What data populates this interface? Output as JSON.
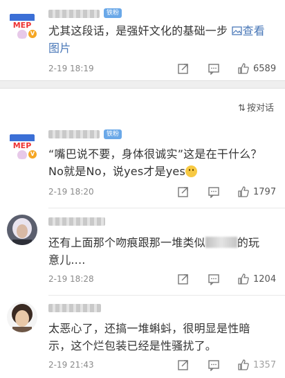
{
  "sort_label": "按对话",
  "comments": [
    {
      "badge": "铁粉",
      "text_parts": [
        "尤其这段话，是强奸文化的基础一步 ",
        "查看图片"
      ],
      "link_icon": "image-icon",
      "time": "2-19 18:19",
      "likes": "6589",
      "avatar_text": "MEP"
    },
    {
      "badge": "铁粉",
      "text_parts": [
        "“嘴巴说不要，身体很诚实”这是在干什么？No就是No，说yes才是yes"
      ],
      "time": "2-19 18:20",
      "likes": "1797",
      "avatar_text": "MEP"
    },
    {
      "text_parts": [
        "还有上面那个吻痕跟那一堆类似",
        "的玩意儿...."
      ],
      "time": "2-19 18:28",
      "likes": "1204"
    },
    {
      "text_parts": [
        "太恶心了，还搞一堆蝌蚪，很明显是性暗示，这个烂包装已经是性骚扰了。"
      ],
      "time": "2-19 21:43",
      "likes": "1357"
    }
  ]
}
